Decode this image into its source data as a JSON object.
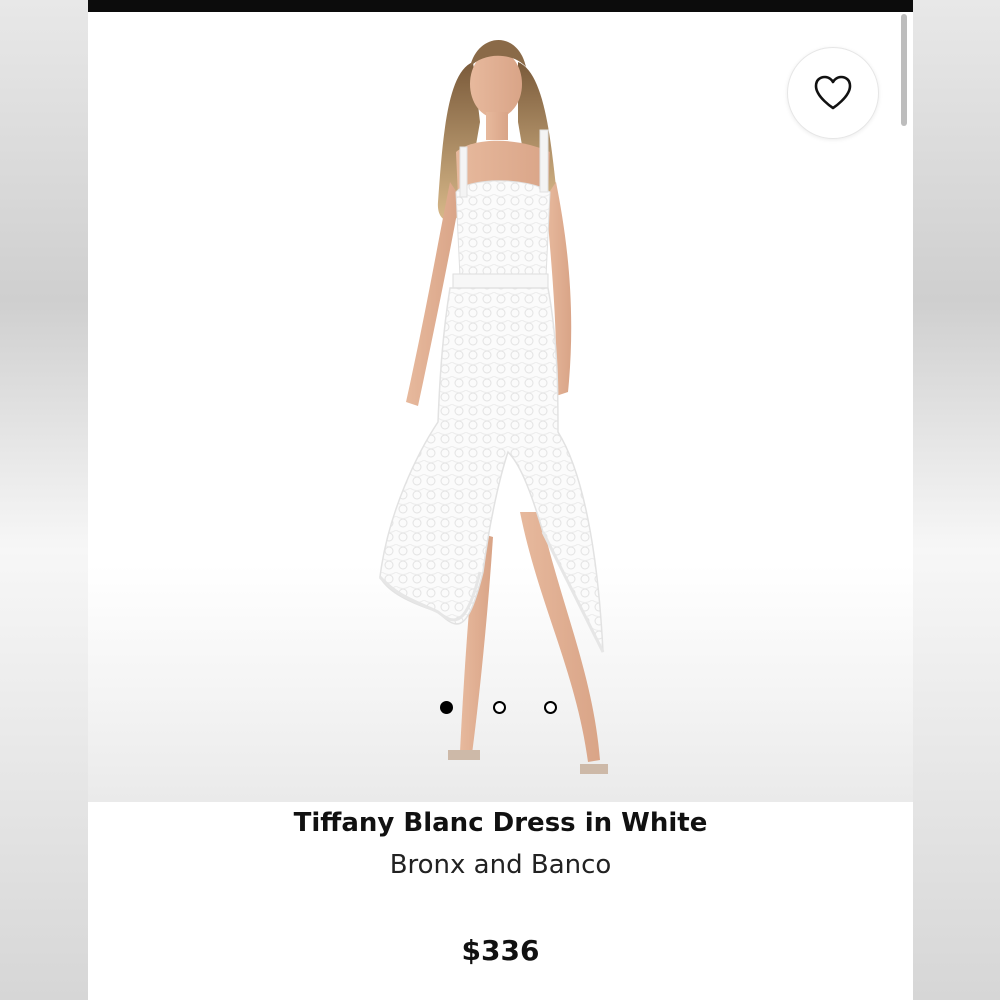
{
  "product": {
    "name": "Tiffany Blanc Dress in White",
    "brand": "Bronx and Banco",
    "price": "$336",
    "image_alt": "Model wearing white lace midi dress with asymmetric ruffle hem"
  },
  "gallery": {
    "image_count": 3,
    "active_index": 0
  },
  "icons": {
    "favorite": "heart-outline-icon"
  },
  "colors": {
    "status_bar": "#0c0c0c",
    "text": "#111111",
    "dot_active": "#000000"
  }
}
